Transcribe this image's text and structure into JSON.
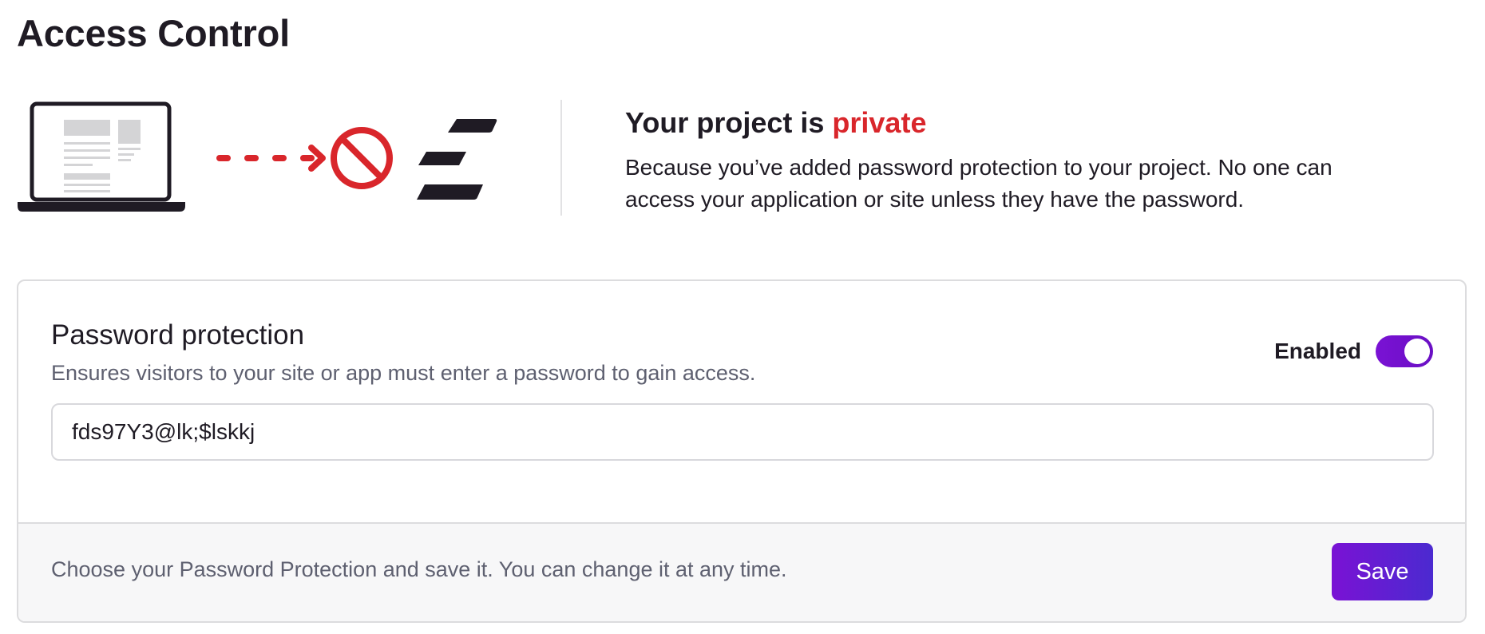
{
  "page": {
    "title": "Access Control"
  },
  "status": {
    "heading_prefix": "Your project is",
    "heading_status": "private",
    "description": "Because you’ve added password protection to your project. No one can access your application or site unless they have the password."
  },
  "password_protection": {
    "title": "Password protection",
    "description": "Ensures visitors to your site or app must enter a password to gain access.",
    "toggle_label": "Enabled",
    "toggle_on": true,
    "password_value": "fds97Y3@lk;$lskkj",
    "footer_text": "Choose your Password Protection and save it. You can change it at any time.",
    "save_label": "Save"
  },
  "icons": {
    "laptop": "laptop-icon",
    "arrow": "dashed-arrow-icon",
    "blocked": "no-entry-icon",
    "logo": "brand-logo-icon"
  },
  "colors": {
    "accent_start": "#7a12d4",
    "accent_end": "#4b2ad0",
    "danger": "#d9262b",
    "text": "#1f1b24",
    "muted": "#5e6070"
  }
}
